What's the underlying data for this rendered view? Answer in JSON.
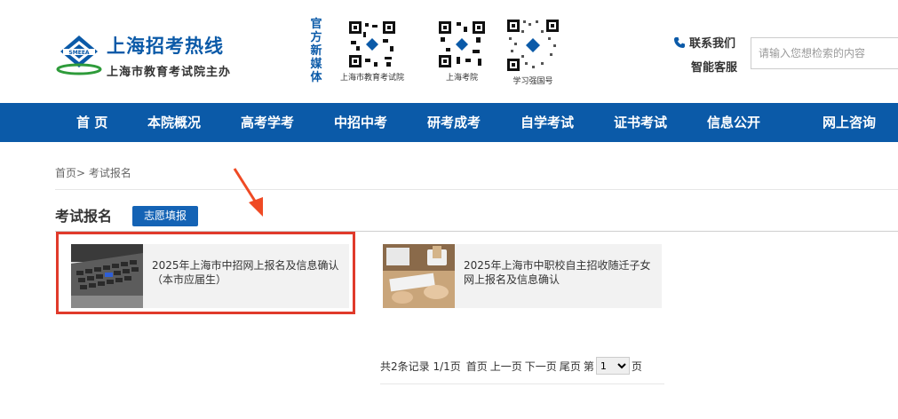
{
  "header": {
    "site_title": "上海招考热线",
    "site_subtitle": "上海市教育考试院主办",
    "official_media_label": "官方新媒体",
    "qr_codes": [
      {
        "caption": "上海市教育考试院"
      },
      {
        "caption": "上海考院"
      },
      {
        "caption": "学习强国号"
      }
    ],
    "contact_label": "联系我们",
    "service_label": "智能客服",
    "search_placeholder": "请输入您想检索的内容"
  },
  "nav": {
    "items": [
      "首 页",
      "本院概况",
      "高考学考",
      "中招中考",
      "研考成考",
      "自学考试",
      "证书考试",
      "信息公开",
      "网上咨询"
    ]
  },
  "breadcrumb": "首页> 考试报名",
  "section": {
    "title": "考试报名",
    "tag_button": "志愿填报"
  },
  "cards": [
    {
      "title_line1": "2025年上海市中招网上报名及信息确认",
      "title_line2": "（本市应届生）"
    },
    {
      "title_line1": "2025年上海市中职校自主招收随迁子女",
      "title_line2": "网上报名及信息确认"
    }
  ],
  "pagination": {
    "summary": "共2条记录 1/1页",
    "first": "首页",
    "prev": "上一页",
    "next": "下一页",
    "last": "尾页",
    "page_prefix": "第",
    "page_value": "1",
    "page_suffix": "页"
  },
  "colors": {
    "brand_blue": "#0b5aa8",
    "button_blue": "#1463b5",
    "highlight_red": "#e03a2b"
  },
  "icons": [
    "site-emblem-icon",
    "qr-code-icon",
    "phone-icon",
    "red-arrow-annotation"
  ]
}
